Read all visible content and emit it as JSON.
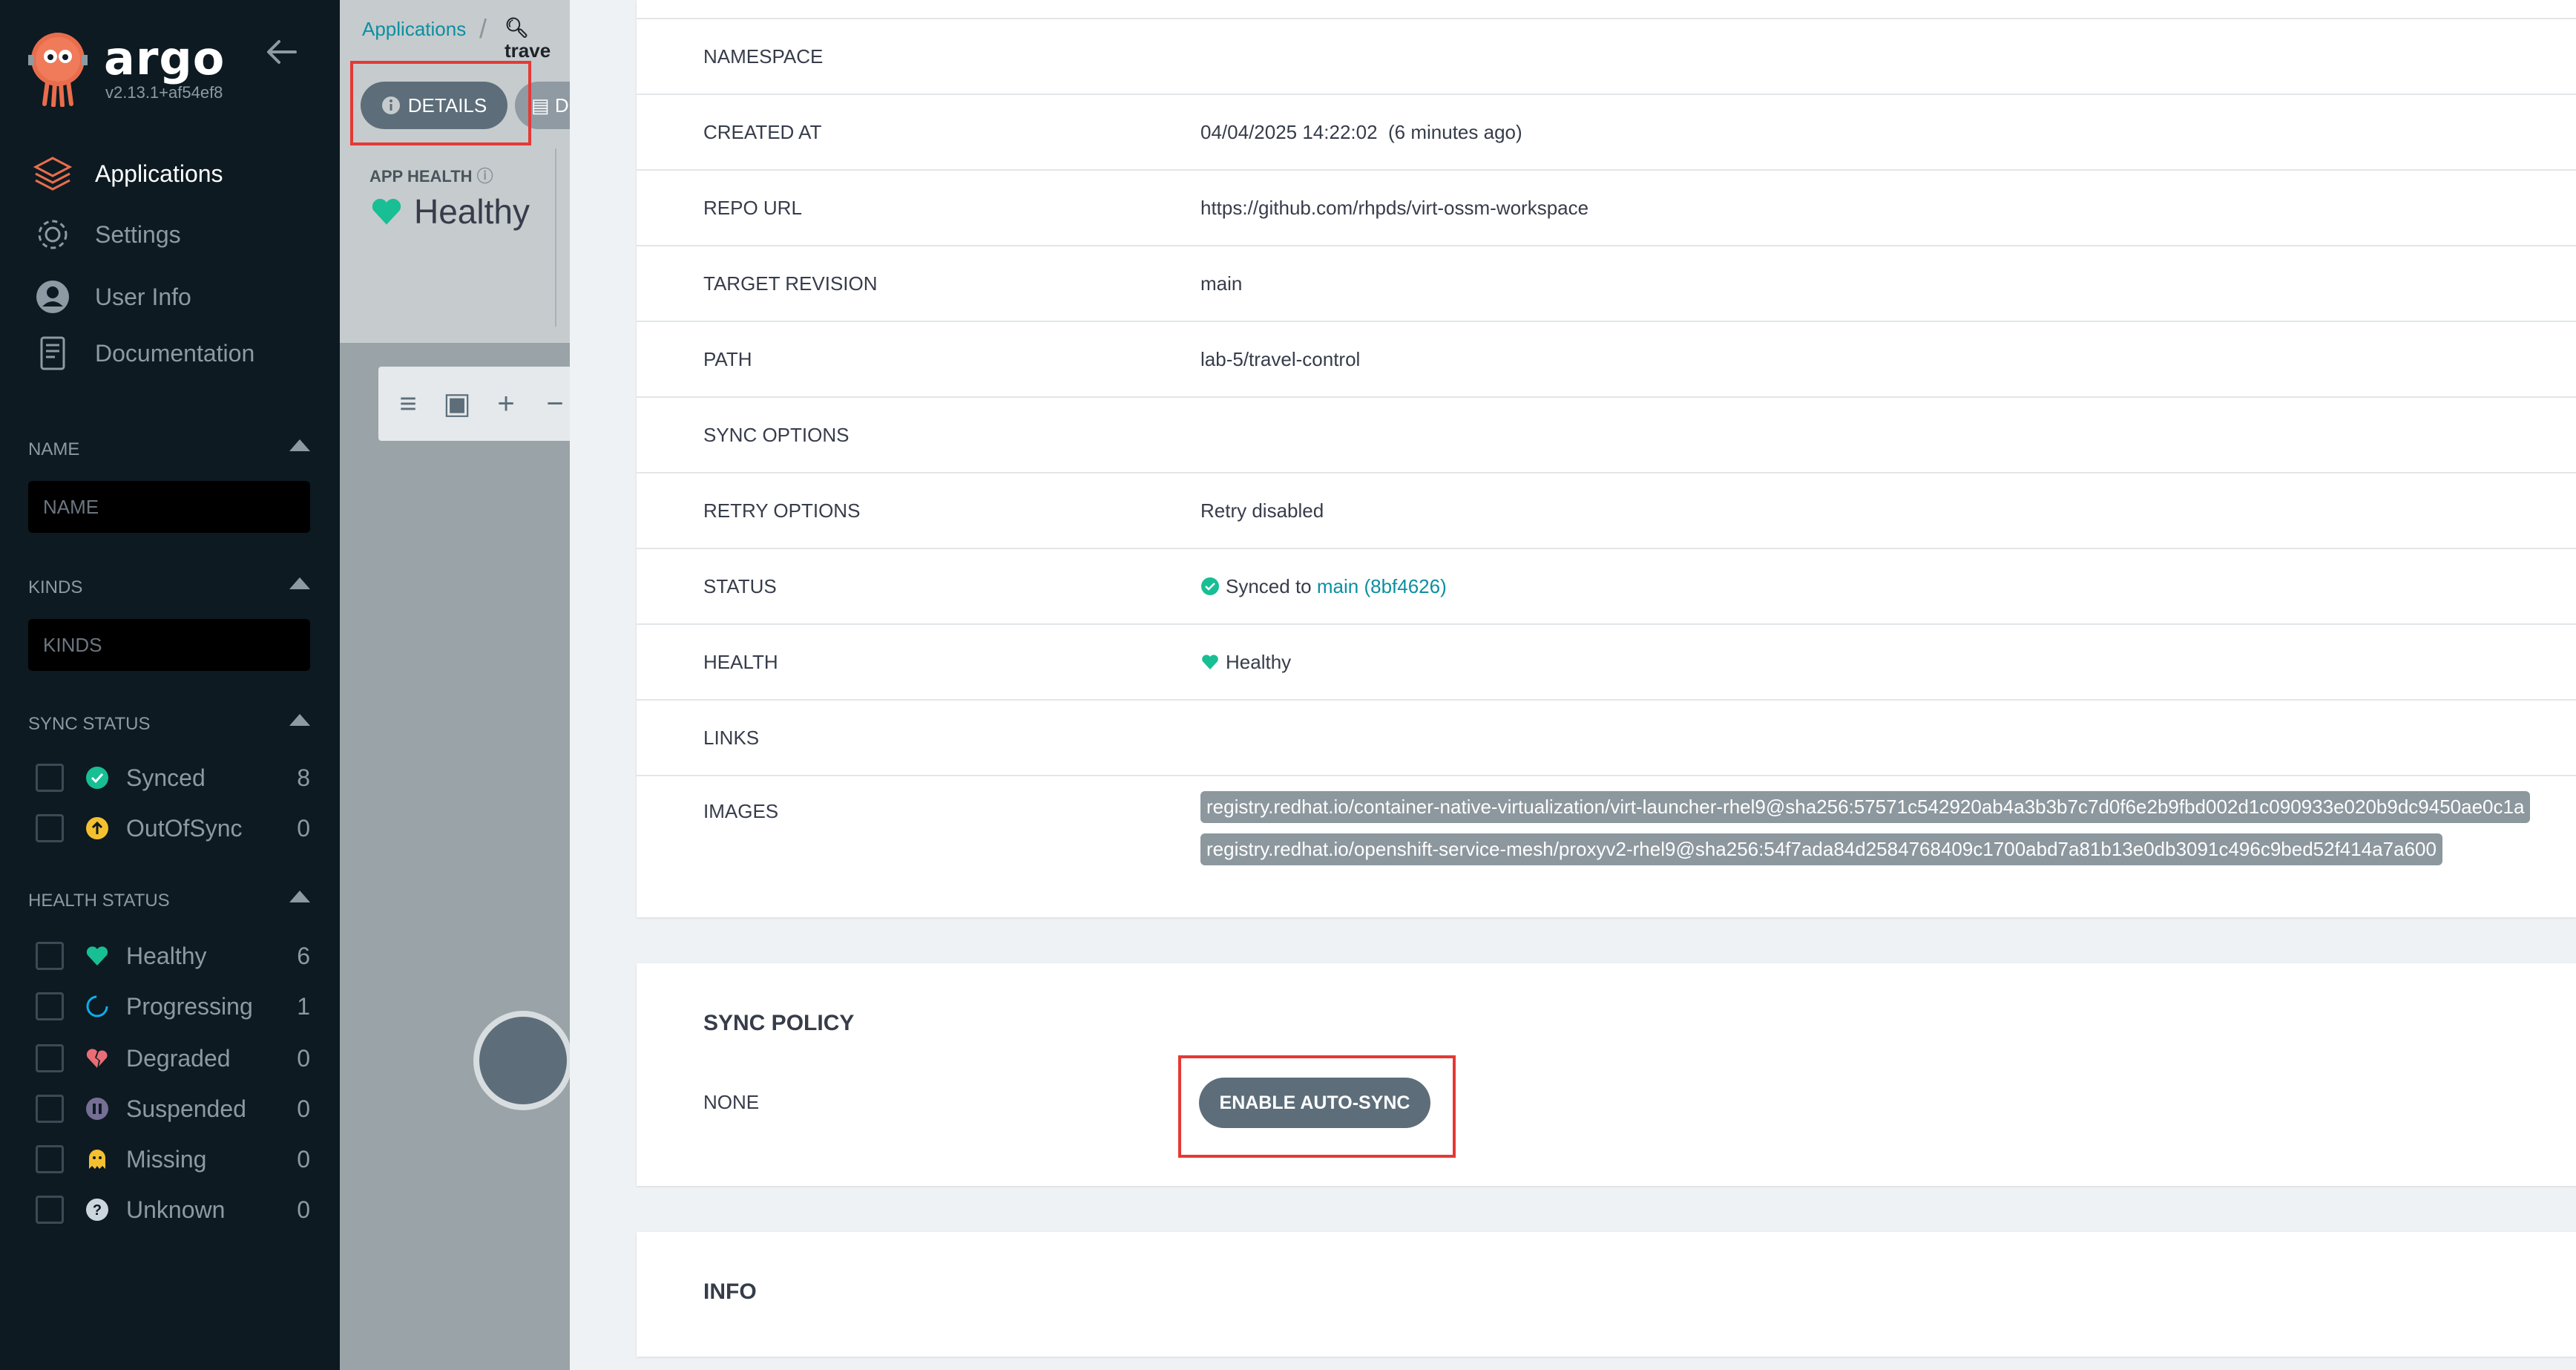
{
  "sidebar": {
    "brand": "argo",
    "version": "v2.13.1+af54ef8",
    "nav": [
      {
        "label": "Applications",
        "icon": "layers-icon"
      },
      {
        "label": "Settings",
        "icon": "gear-icon"
      },
      {
        "label": "User Info",
        "icon": "user-icon"
      },
      {
        "label": "Documentation",
        "icon": "book-icon"
      }
    ],
    "filters": {
      "name_header": "NAME",
      "name_placeholder": "NAME",
      "kinds_header": "KINDS",
      "kinds_placeholder": "KINDS",
      "sync_header": "SYNC STATUS",
      "sync_items": [
        {
          "label": "Synced",
          "count": "8",
          "color": "#18be94"
        },
        {
          "label": "OutOfSync",
          "count": "0",
          "color": "#f4c030"
        }
      ],
      "health_header": "HEALTH STATUS",
      "health_items": [
        {
          "label": "Healthy",
          "count": "6",
          "color": "#18be94"
        },
        {
          "label": "Progressing",
          "count": "1",
          "color": "#0dadea"
        },
        {
          "label": "Degraded",
          "count": "0",
          "color": "#e96d76"
        },
        {
          "label": "Suspended",
          "count": "0",
          "color": "#766f94"
        },
        {
          "label": "Missing",
          "count": "0",
          "color": "#f4c030"
        },
        {
          "label": "Unknown",
          "count": "0",
          "color": "#ccd6dd"
        }
      ]
    }
  },
  "app_panel": {
    "breadcrumb": "Applications",
    "search_text": "trave",
    "details_button": "DETAILS",
    "next_button": "D",
    "app_health_label": "APP HEALTH",
    "app_health_value": "Healthy"
  },
  "details": {
    "rows": [
      {
        "key": "NAMESPACE",
        "value": ""
      },
      {
        "key": "CREATED AT",
        "value": "04/04/2025 14:22:02  (6 minutes ago)"
      },
      {
        "key": "REPO URL",
        "value": "https://github.com/rhpds/virt-ossm-workspace"
      },
      {
        "key": "TARGET REVISION",
        "value": "main"
      },
      {
        "key": "PATH",
        "value": "lab-5/travel-control"
      },
      {
        "key": "SYNC OPTIONS",
        "value": ""
      },
      {
        "key": "RETRY OPTIONS",
        "value": "Retry disabled"
      },
      {
        "key": "STATUS",
        "value": "Synced to",
        "link": "main (8bf4626)"
      },
      {
        "key": "HEALTH",
        "value": "Healthy"
      },
      {
        "key": "LINKS",
        "value": ""
      },
      {
        "key": "IMAGES",
        "value": ""
      }
    ],
    "images": [
      "registry.redhat.io/container-native-virtualization/virt-launcher-rhel9@sha256:57571c542920ab4a3b3b7c7d0f6e2b9fbd002d1c090933e020b9dc9450ae0c1a",
      "registry.redhat.io/openshift-service-mesh/proxyv2-rhel9@sha256:54f7ada84d2584768409c1700abd7a81b13e0db3091c496c9bed52f414a7a600"
    ],
    "sync_policy_title": "SYNC POLICY",
    "sync_policy_key": "NONE",
    "enable_autosync_button": "ENABLE AUTO-SYNC",
    "info_title": "INFO"
  },
  "colors": {
    "accent_link": "#0c8fa1",
    "highlight_box": "#e53935",
    "healthy": "#18be94"
  }
}
